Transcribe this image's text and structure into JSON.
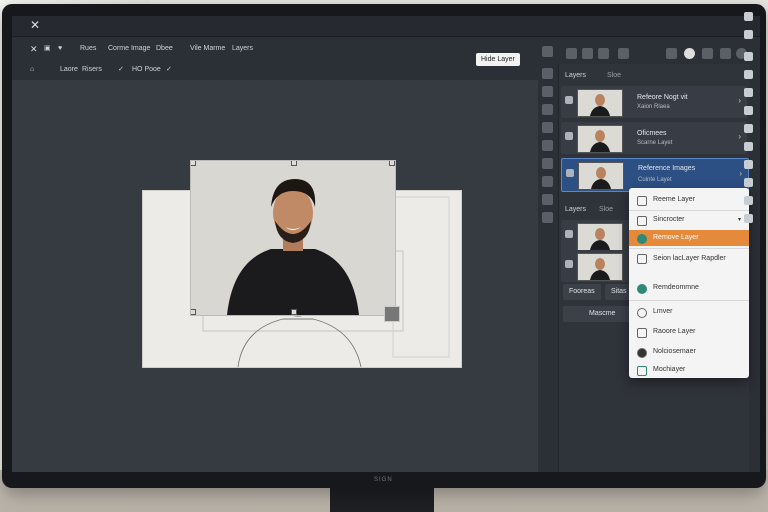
{
  "window": {
    "close_glyph": "✕"
  },
  "menu": {
    "items": [
      "Rues",
      "Corme Image",
      "Dbee",
      "Vile Marme",
      "Layers"
    ]
  },
  "toolbar2": {
    "items": [
      "Laore",
      "Risers",
      "HO Pooe"
    ]
  },
  "tooltip": {
    "text": "Hide Layer"
  },
  "panel": {
    "tab_layers": "Layers",
    "tab_second": "Sloe",
    "section_layers": "Layers",
    "section_second": "Sloe",
    "rows": [
      {
        "title": "Refeore Nogt vit",
        "sub": "Xaion Rlaea"
      },
      {
        "title": "Oficmees",
        "sub": "Scarne Layet"
      },
      {
        "title": "Reference Images",
        "sub": "Cuinte Layet"
      }
    ],
    "btn_1": "Fooreas",
    "btn_2": "Sitas",
    "btn_3": "Mascme"
  },
  "context_menu": {
    "items": [
      {
        "label": "Reeme Layer",
        "icon": "layer-icon",
        "highlighted": false
      },
      {
        "label": "Sincrocter",
        "icon": "sync-icon",
        "highlighted": false
      },
      {
        "label": "Remove Layer",
        "icon": "shield-icon",
        "highlighted": true
      },
      {
        "label": "Seion lacLayer Rapdler",
        "icon": "rect-icon",
        "highlighted": false
      },
      {
        "label": "Remdeommne",
        "icon": "circle-icon",
        "highlighted": false
      },
      {
        "label": "Lmver",
        "icon": "heart-icon",
        "highlighted": false
      },
      {
        "label": "Raoore Layer",
        "icon": "link-icon",
        "highlighted": false
      },
      {
        "label": "Nolciosemaer",
        "icon": "palette-icon",
        "highlighted": false
      },
      {
        "label": "Mochiayer",
        "icon": "brush-icon",
        "highlighted": false
      }
    ]
  },
  "monitor": {
    "brand": "SIGN"
  },
  "colors": {
    "accent_orange": "#e58a3b",
    "active_blue": "#2c4f84"
  }
}
